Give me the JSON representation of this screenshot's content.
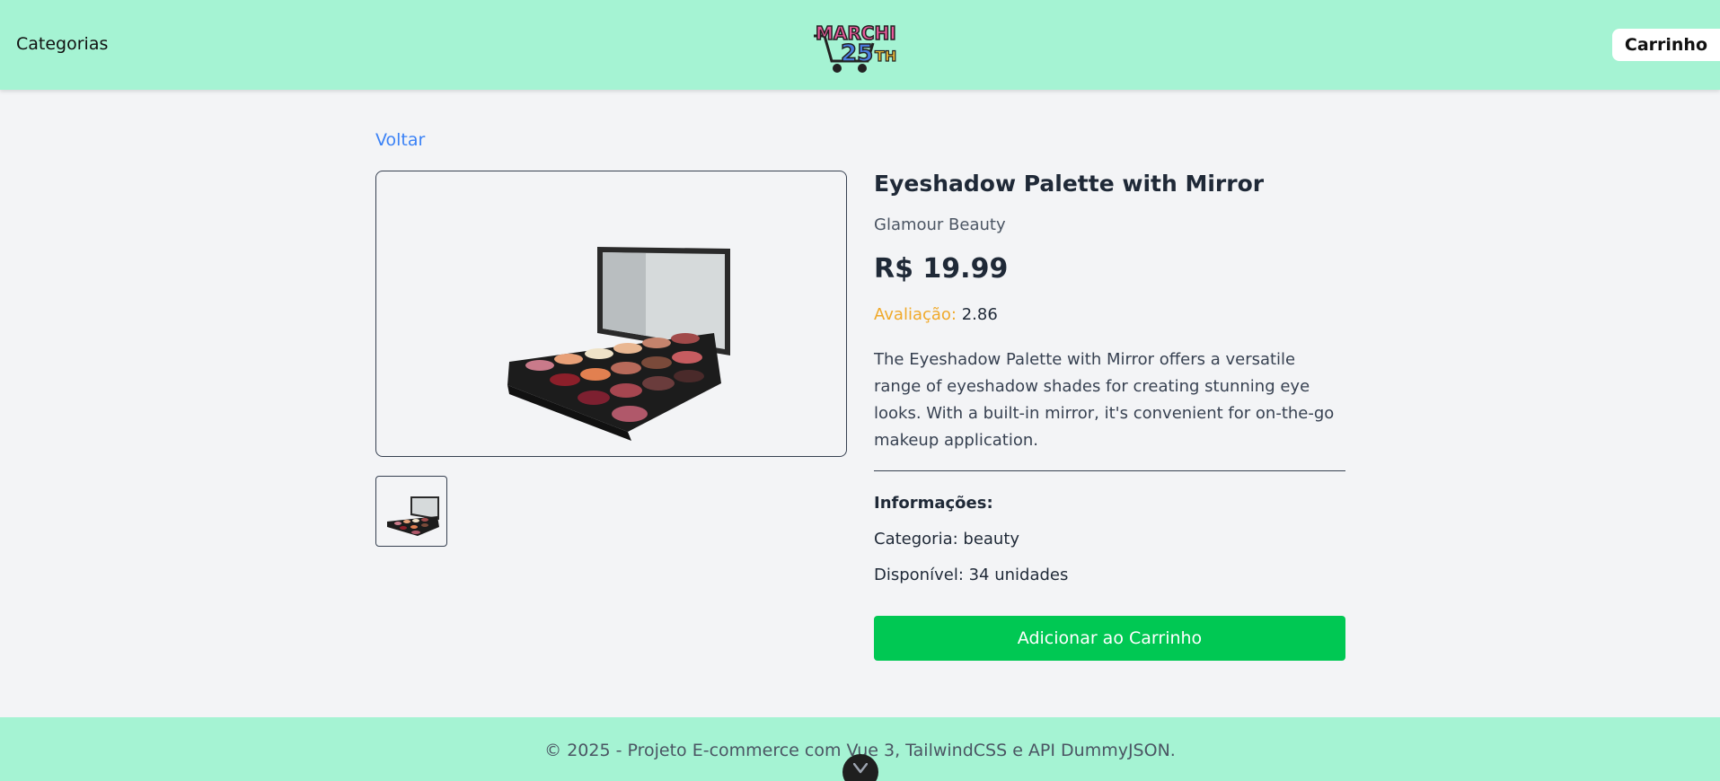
{
  "header": {
    "categories_label": "Categorias",
    "logo_text": "MARCHI 25TH",
    "cart_label": "Carrinho"
  },
  "nav": {
    "back_label": "Voltar"
  },
  "product": {
    "title": "Eyeshadow Palette with Mirror",
    "brand": "Glamour Beauty",
    "price": "R$ 19.99",
    "rating_label": "Avaliação:",
    "rating_value": "2.86",
    "description": "The Eyeshadow Palette with Mirror offers a versatile range of eyeshadow shades for creating stunning eye looks. With a built-in mirror, it's convenient for on-the-go makeup application.",
    "info_heading": "Informações:",
    "category_text": "Categoria: beauty",
    "stock_text": "Disponível: 34 unidades",
    "add_to_cart_label": "Adicionar ao Carrinho"
  },
  "footer": {
    "text": "© 2025 - Projeto E-commerce com Vue 3, TailwindCSS e API DummyJSON."
  },
  "colors": {
    "header_bg": "#a5f3d3",
    "link": "#3b82f6",
    "rating_label": "#f0a92a",
    "button_green": "#00c853"
  },
  "icons": {
    "scroll": "chevron-down-icon"
  }
}
